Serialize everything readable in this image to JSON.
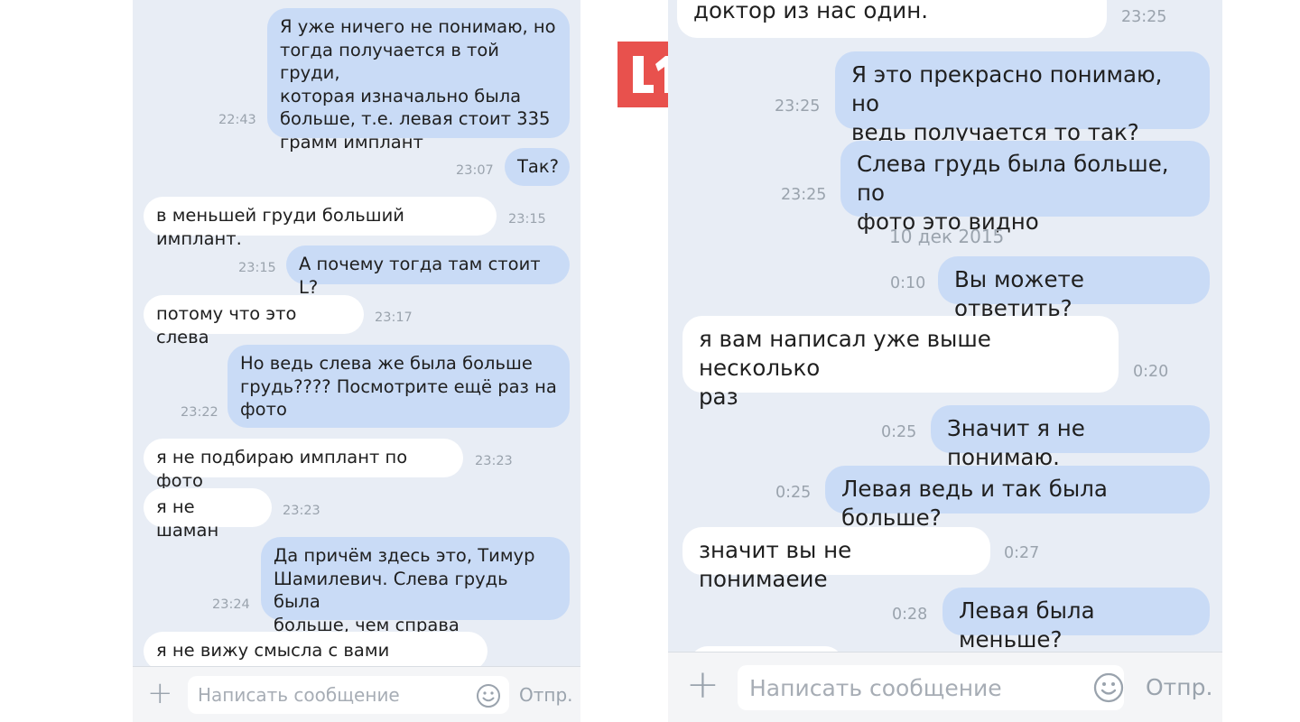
{
  "left_chat": {
    "messages": [
      {
        "dir": "out",
        "text": "Я уже ничего не понимаю, но\nтогда получается в той груди,\nкоторая изначально была\nбольше, т.е. левая стоит 335\nграмм имплант",
        "time": "22:43"
      },
      {
        "dir": "out",
        "text": "Так?",
        "time": "23:07"
      },
      {
        "dir": "in",
        "text": "в меньшей груди больший имплант.",
        "time": "23:15"
      },
      {
        "dir": "out",
        "text": "А почему тогда там стоит L?",
        "time": "23:15"
      },
      {
        "dir": "in",
        "text": "потому что это слева",
        "time": "23:17"
      },
      {
        "dir": "out",
        "text": "Но ведь слева же была больше\nгрудь???? Посмотрите ещё раз на\nфото",
        "time": "23:22"
      },
      {
        "dir": "in",
        "text": "я не подбираю имплант по фото",
        "time": "23:23"
      },
      {
        "dir": "in",
        "text": "я не шаман",
        "time": "23:23"
      },
      {
        "dir": "out",
        "text": "Да причём здесь это, Тимур\nШамилевич. Слева грудь была\nбольше, чем справа",
        "time": "23:24"
      },
      {
        "dir": "in",
        "text": "я не вижу смысла с вами спорить.",
        "time": ""
      }
    ],
    "composer": {
      "plus_icon": "plus-icon",
      "placeholder": "Написать сообщение",
      "emoji_icon": "smiley-icon",
      "send_label": "Отпр."
    }
  },
  "right_chat": {
    "messages": [
      {
        "dir": "in",
        "text": "доктор из нас один.",
        "time": "23:25"
      },
      {
        "dir": "out",
        "text": "Я это прекрасно понимаю, но\nведь получается то так?",
        "time": "23:25"
      },
      {
        "dir": "out",
        "text": "Слева грудь была больше, по\nфото это видно",
        "time": "23:25"
      },
      {
        "dir": "out",
        "text": "Вы можете ответить?",
        "time": "0:10"
      },
      {
        "dir": "in",
        "text": "я вам написал уже выше несколько\nраз",
        "time": "0:20"
      },
      {
        "dir": "out",
        "text": "Значит я не понимаю.",
        "time": "0:25"
      },
      {
        "dir": "out",
        "text": "Левая ведь и так была больше?",
        "time": "0:25"
      },
      {
        "dir": "in",
        "text": "значит вы не понимаеие",
        "time": "0:27"
      },
      {
        "dir": "out",
        "text": "Левая была меньше?",
        "time": "0:28"
      }
    ],
    "date_separator": "10 дек 2015",
    "composer": {
      "plus_icon": "plus-icon",
      "placeholder": "Написать сообщение",
      "emoji_icon": "smiley-icon",
      "send_label": "Отпр."
    }
  },
  "watermark": {
    "logo_text": "L1",
    "logo_color": "#e8514d"
  },
  "colors": {
    "outgoing_bubble": "#c9dbf6",
    "incoming_bubble": "#ffffff",
    "chat_background": "#e8edf5",
    "timestamp": "#9aa3ad"
  }
}
